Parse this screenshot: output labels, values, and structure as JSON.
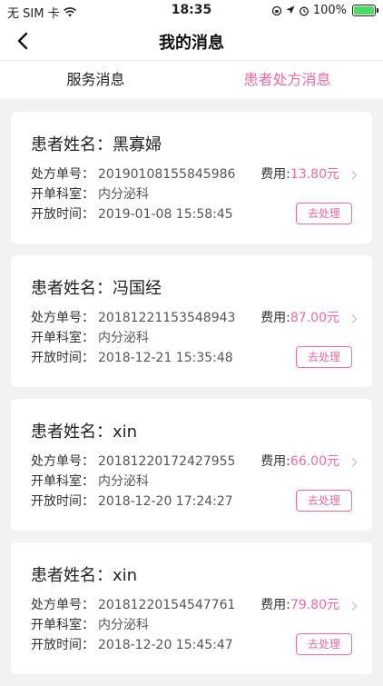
{
  "status_bar": {
    "carrier": "无 SIM 卡",
    "time": "18:35",
    "battery": "100%",
    "battery_level": 1.0
  },
  "nav": {
    "title": "我的消息",
    "back_icon": "chevron-left-icon"
  },
  "tabs": [
    {
      "label": "服务消息",
      "active": false
    },
    {
      "label": "患者处方消息",
      "active": true
    }
  ],
  "colors": {
    "accent": "#ee6aa7",
    "background": "#f2f2f2",
    "card": "#ffffff"
  },
  "labels": {
    "patient_name": "患者姓名：",
    "order_no": "处方单号：",
    "department": "开单科室：",
    "time": "开放时间：",
    "fee": "费用:",
    "action": "去处理"
  },
  "prescriptions": [
    {
      "patient_name": "黑寡婦",
      "order_no": "20190108155845986",
      "department": "内分泌科",
      "time": "2019-01-08 15:58:45",
      "fee": "13.80元"
    },
    {
      "patient_name": "冯国经",
      "order_no": "20181221153548943",
      "department": "内分泌科",
      "time": "2018-12-21 15:35:48",
      "fee": "87.00元"
    },
    {
      "patient_name": "xin",
      "order_no": "20181220172427955",
      "department": "内分泌科",
      "time": "2018-12-20 17:24:27",
      "fee": "66.00元"
    },
    {
      "patient_name": "xin",
      "order_no": "20181220154547761",
      "department": "内分泌科",
      "time": "2018-12-20 15:45:47",
      "fee": "79.80元"
    }
  ]
}
